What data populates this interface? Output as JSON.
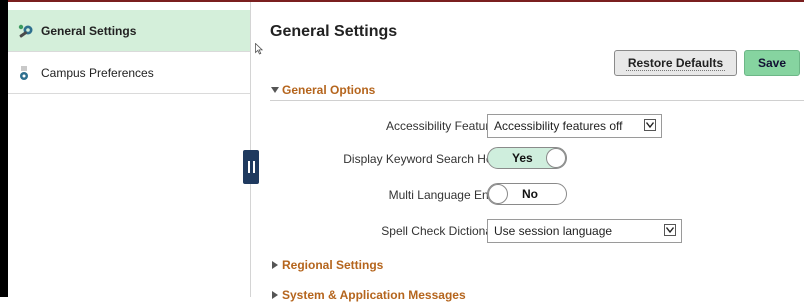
{
  "sidebar": {
    "items": [
      {
        "label": "General Settings",
        "icon": "wrench-gear-icon",
        "active": true
      },
      {
        "label": "Campus Preferences",
        "icon": "gear-small-icon",
        "active": false
      }
    ]
  },
  "main": {
    "title": "General Settings",
    "buttons": {
      "restore_label": "Restore Defaults",
      "save_label": "Save"
    },
    "sections": [
      {
        "label": "General Options",
        "expanded": true
      },
      {
        "label": "Regional Settings",
        "expanded": false
      },
      {
        "label": "System & Application Messages",
        "expanded": false
      }
    ],
    "fields": {
      "accessibility": {
        "label": "Accessibility Features",
        "value": "Accessibility features off"
      },
      "keyword_help": {
        "label": "Display Keyword Search Help",
        "value": "Yes"
      },
      "multi_language": {
        "label": "Multi Language Entry",
        "value": "No"
      },
      "spell_check": {
        "label": "Spell Check Dictionary",
        "value": "Use session language"
      }
    }
  },
  "colors": {
    "active_nav": "#d4efda",
    "section_header": "#b5651d",
    "save_button": "#86d4a0",
    "collapse_handle": "#1f3a5f"
  }
}
